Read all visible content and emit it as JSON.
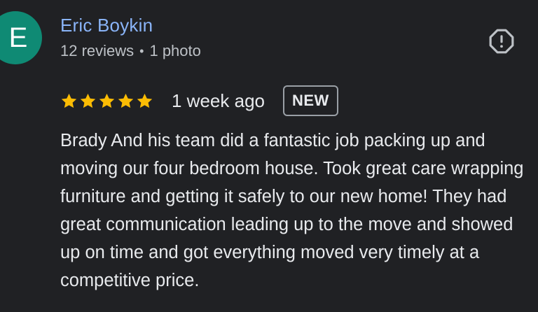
{
  "review": {
    "avatar_letter": "E",
    "avatar_color": "#0f8a74",
    "author_name": "Eric Boykin",
    "reviews_count": "12 reviews",
    "separator": "•",
    "photos_count": "1 photo",
    "report_icon": "report-flag-icon",
    "rating": 5,
    "rating_max": 5,
    "star_color": "#fbbc04",
    "time_ago": "1 week ago",
    "badge": "NEW",
    "text": "Brady And his team did a fantastic job packing up and moving our four bedroom house. Took great care wrapping furniture and getting it safely to our new home! They had great communication leading up to the move and showed up on time and got everything moved very timely at a competitive price."
  }
}
